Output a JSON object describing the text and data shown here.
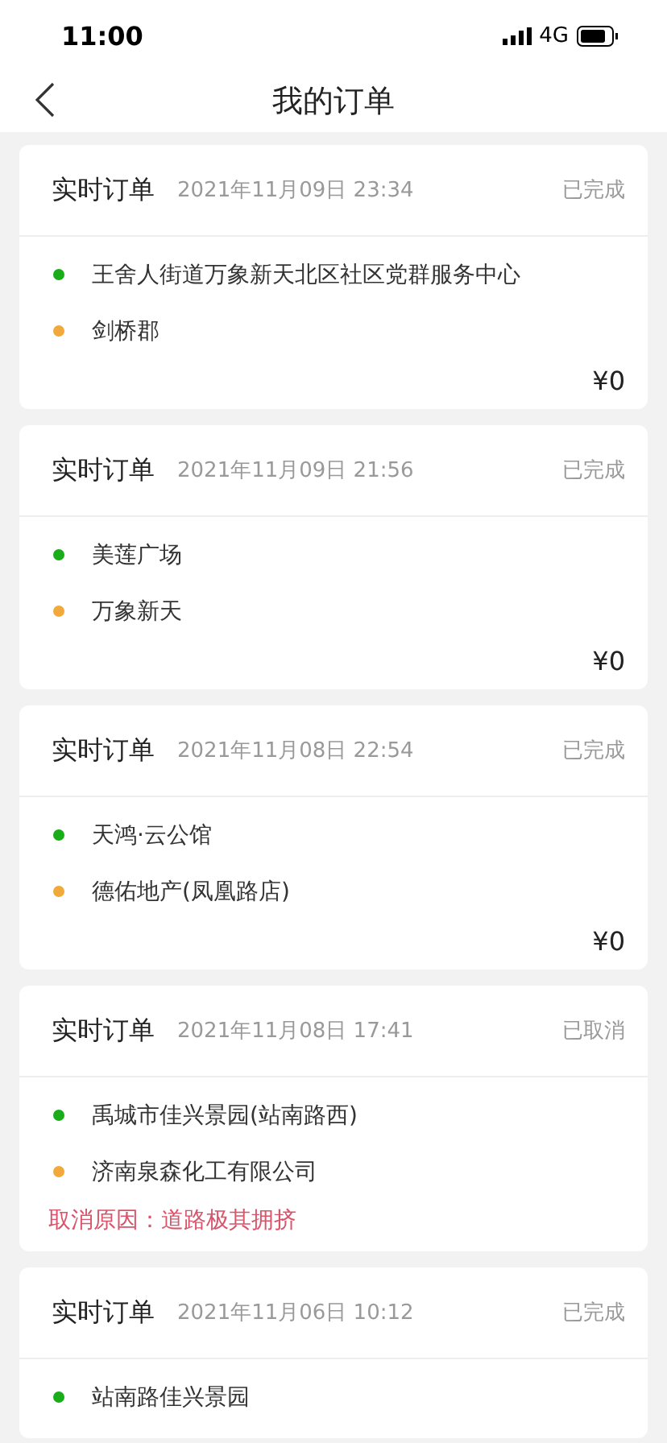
{
  "status_bar": {
    "time": "11:00",
    "network": "4G"
  },
  "nav": {
    "title": "我的订单"
  },
  "orders": [
    {
      "type": "实时订单",
      "time": "2021年11月09日 23:34",
      "status": "已完成",
      "stops": [
        {
          "kind": "start",
          "name": "王舍人街道万象新天北区社区党群服务中心"
        },
        {
          "kind": "end",
          "name": "剑桥郡"
        }
      ],
      "price": "¥0"
    },
    {
      "type": "实时订单",
      "time": "2021年11月09日 21:56",
      "status": "已完成",
      "stops": [
        {
          "kind": "start",
          "name": "美莲广场"
        },
        {
          "kind": "end",
          "name": "万象新天"
        }
      ],
      "price": "¥0"
    },
    {
      "type": "实时订单",
      "time": "2021年11月08日 22:54",
      "status": "已完成",
      "stops": [
        {
          "kind": "start",
          "name": "天鸿·云公馆"
        },
        {
          "kind": "end",
          "name": "德佑地产(凤凰路店)"
        }
      ],
      "price": "¥0"
    },
    {
      "type": "实时订单",
      "time": "2021年11月08日 17:41",
      "status": "已取消",
      "stops": [
        {
          "kind": "start",
          "name": "禹城市佳兴景园(站南路西)"
        },
        {
          "kind": "end",
          "name": "济南泉森化工有限公司"
        }
      ],
      "cancel_reason": "取消原因：道路极其拥挤"
    },
    {
      "type": "实时订单",
      "time": "2021年11月06日 10:12",
      "status": "已完成",
      "stops": [
        {
          "kind": "start",
          "name": "站南路佳兴景园"
        }
      ]
    }
  ]
}
